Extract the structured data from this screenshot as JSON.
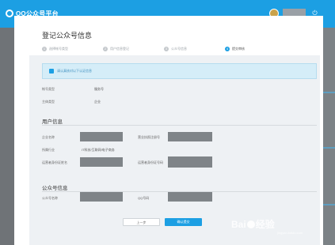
{
  "topbar": {
    "app_title": "QQ公众号平台",
    "colors": {
      "bar": "#1c9fe3"
    }
  },
  "dialog": {
    "title": "登记公众号信息",
    "steps": [
      {
        "num": "1",
        "label": "选择帐号类型",
        "active": false
      },
      {
        "num": "2",
        "label": "用户信息登记",
        "active": false
      },
      {
        "num": "3",
        "label": "公众号信息",
        "active": false
      },
      {
        "num": "4",
        "label": "提交审核",
        "active": true
      }
    ],
    "notice": "请认真核对以下认证信息",
    "summary": {
      "account_type_label": "帐号类型",
      "account_type_value": "服务号",
      "subject_type_label": "主体类型",
      "subject_type_value": "企业"
    },
    "user_info": {
      "title": "用户信息",
      "company_name_label": "企业名称",
      "license_no_label": "营业执照注册号",
      "industry_label": "所属行业",
      "industry_value": "IT科技/互联网/电子商务",
      "operator_name_label": "运营者身份证姓名",
      "operator_id_label": "运营者身份证号码"
    },
    "public_info": {
      "title": "公众号信息",
      "name_label": "公众号名称",
      "qq_label": "QQ号码"
    },
    "buttons": {
      "prev": "上一步",
      "submit": "确认提交"
    }
  },
  "watermark": {
    "text_before": "Bai",
    "text_after": "经验",
    "sub": "jingyan.baidu.com"
  }
}
